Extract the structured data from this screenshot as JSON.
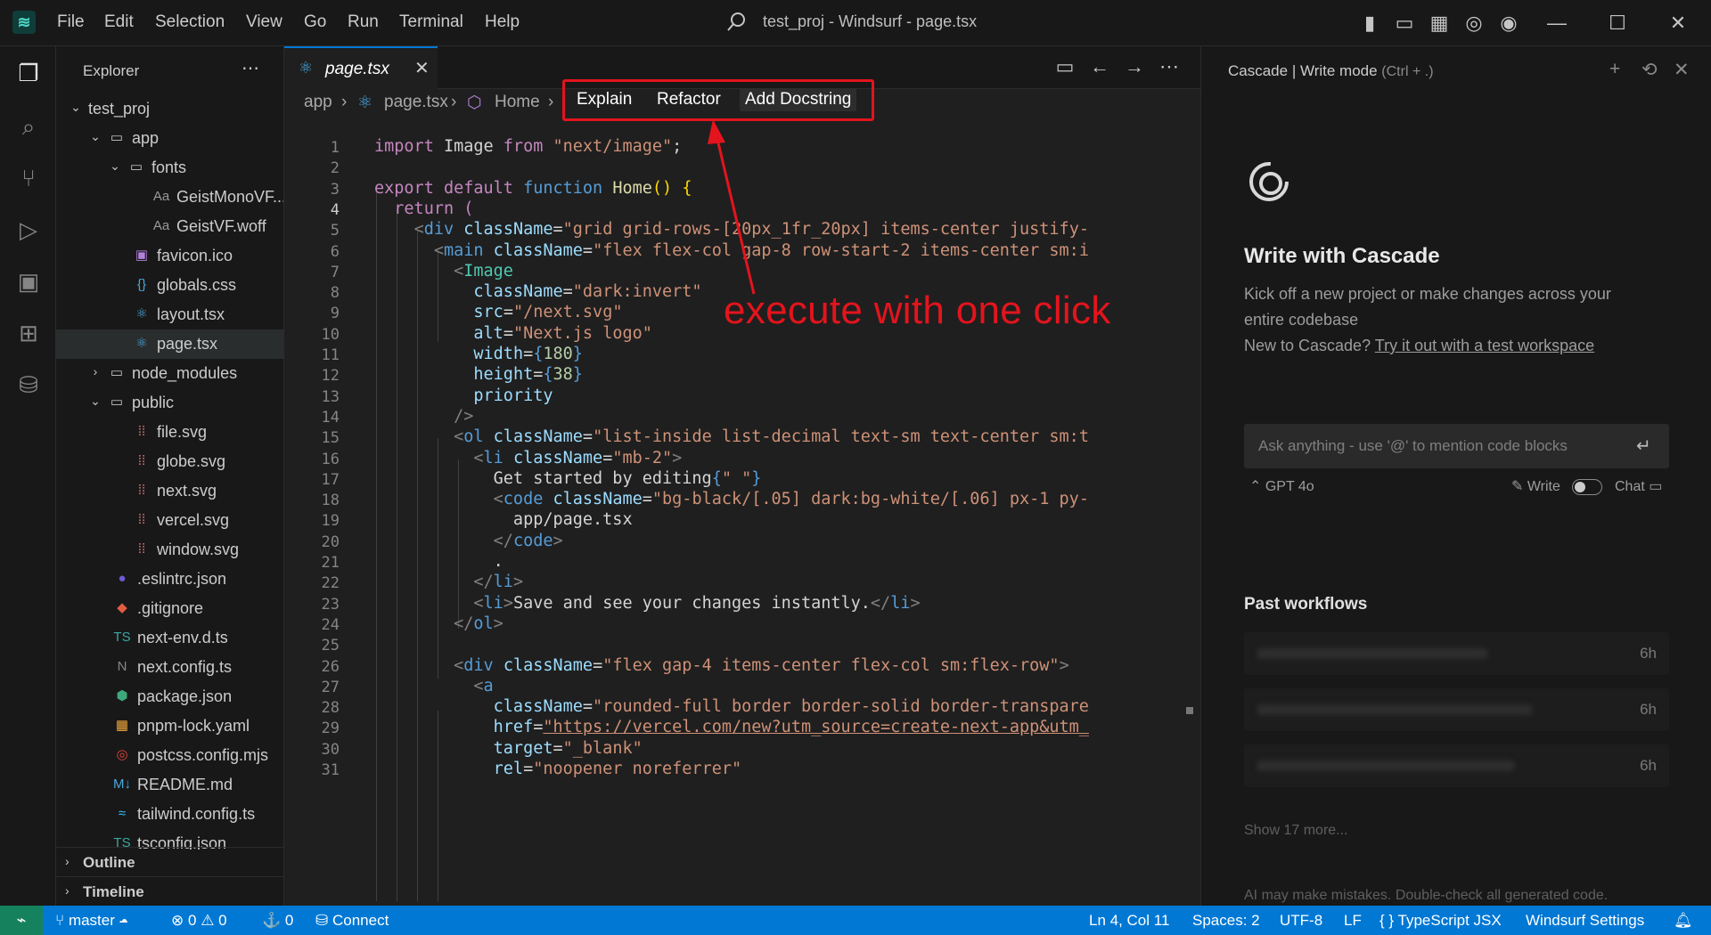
{
  "titlebar": {
    "menus": [
      "File",
      "Edit",
      "Selection",
      "View",
      "Go",
      "Run",
      "Terminal",
      "Help"
    ],
    "title": "test_proj - Windsurf - page.tsx"
  },
  "sidebar": {
    "title": "Explorer",
    "tree": [
      {
        "depth": 0,
        "chev": "v",
        "name": "test_proj",
        "kind": "root"
      },
      {
        "depth": 1,
        "chev": "v",
        "name": "app",
        "kind": "folder"
      },
      {
        "depth": 2,
        "chev": "v",
        "name": "fonts",
        "kind": "folder"
      },
      {
        "depth": 3,
        "chev": "",
        "name": "GeistMonoVF....",
        "kind": "font"
      },
      {
        "depth": 3,
        "chev": "",
        "name": "GeistVF.woff",
        "kind": "font"
      },
      {
        "depth": 2,
        "chev": "",
        "name": "favicon.ico",
        "kind": "image"
      },
      {
        "depth": 2,
        "chev": "",
        "name": "globals.css",
        "kind": "css"
      },
      {
        "depth": 2,
        "chev": "",
        "name": "layout.tsx",
        "kind": "react"
      },
      {
        "depth": 2,
        "chev": "",
        "name": "page.tsx",
        "kind": "react",
        "selected": true
      },
      {
        "depth": 1,
        "chev": ">",
        "name": "node_modules",
        "kind": "folder"
      },
      {
        "depth": 1,
        "chev": "v",
        "name": "public",
        "kind": "folder"
      },
      {
        "depth": 2,
        "chev": "",
        "name": "file.svg",
        "kind": "svg"
      },
      {
        "depth": 2,
        "chev": "",
        "name": "globe.svg",
        "kind": "svg"
      },
      {
        "depth": 2,
        "chev": "",
        "name": "next.svg",
        "kind": "svg"
      },
      {
        "depth": 2,
        "chev": "",
        "name": "vercel.svg",
        "kind": "svg"
      },
      {
        "depth": 2,
        "chev": "",
        "name": "window.svg",
        "kind": "svg"
      },
      {
        "depth": 1,
        "chev": "",
        "name": ".eslintrc.json",
        "kind": "eslint"
      },
      {
        "depth": 1,
        "chev": "",
        "name": ".gitignore",
        "kind": "git"
      },
      {
        "depth": 1,
        "chev": "",
        "name": "next-env.d.ts",
        "kind": "ts"
      },
      {
        "depth": 1,
        "chev": "",
        "name": "next.config.ts",
        "kind": "next"
      },
      {
        "depth": 1,
        "chev": "",
        "name": "package.json",
        "kind": "npm"
      },
      {
        "depth": 1,
        "chev": "",
        "name": "pnpm-lock.yaml",
        "kind": "pnpm"
      },
      {
        "depth": 1,
        "chev": "",
        "name": "postcss.config.mjs",
        "kind": "postcss"
      },
      {
        "depth": 1,
        "chev": "",
        "name": "README.md",
        "kind": "md"
      },
      {
        "depth": 1,
        "chev": "",
        "name": "tailwind.config.ts",
        "kind": "tailwind"
      },
      {
        "depth": 1,
        "chev": "",
        "name": "tsconfig.json",
        "kind": "ts"
      }
    ],
    "outline_label": "Outline",
    "timeline_label": "Timeline"
  },
  "editor": {
    "tab_label": "page.tsx",
    "breadcrumb": [
      "app",
      "page.tsx",
      "Home"
    ],
    "code_lens": [
      "Explain",
      "Refactor",
      "Add Docstring"
    ],
    "annotation": "execute with one click",
    "current_line": 4
  },
  "panel": {
    "title": "Cascade | Write mode",
    "title_hint": "(Ctrl + .)",
    "heading": "Write with Cascade",
    "intro_line1": "Kick off a new project or make changes across your",
    "intro_line2": "entire codebase",
    "intro_line3_prefix": "New to Cascade?",
    "intro_link": "Try it out with a test workspace",
    "input_placeholder": "Ask anything - use '@' to mention code blocks",
    "model": "GPT 4o",
    "write_label": "Write",
    "chat_label": "Chat",
    "past_heading": "Past workflows",
    "workflows": [
      {
        "age": "6h"
      },
      {
        "age": "6h"
      },
      {
        "age": "6h"
      }
    ],
    "show_more": "Show 17 more...",
    "disclaimer": "AI may make mistakes. Double-check all generated code."
  },
  "statusbar": {
    "branch": "master",
    "errors": "0",
    "warnings": "0",
    "ports": "0",
    "connect": "Connect",
    "position": "Ln 4, Col 11",
    "spaces": "Spaces: 2",
    "encoding": "UTF-8",
    "eol": "LF",
    "language": "TypeScript JSX",
    "settings": "Windsurf Settings"
  },
  "colors": {
    "accent": "#0078d4",
    "annotation": "#e3141d",
    "remote": "#16825d"
  }
}
